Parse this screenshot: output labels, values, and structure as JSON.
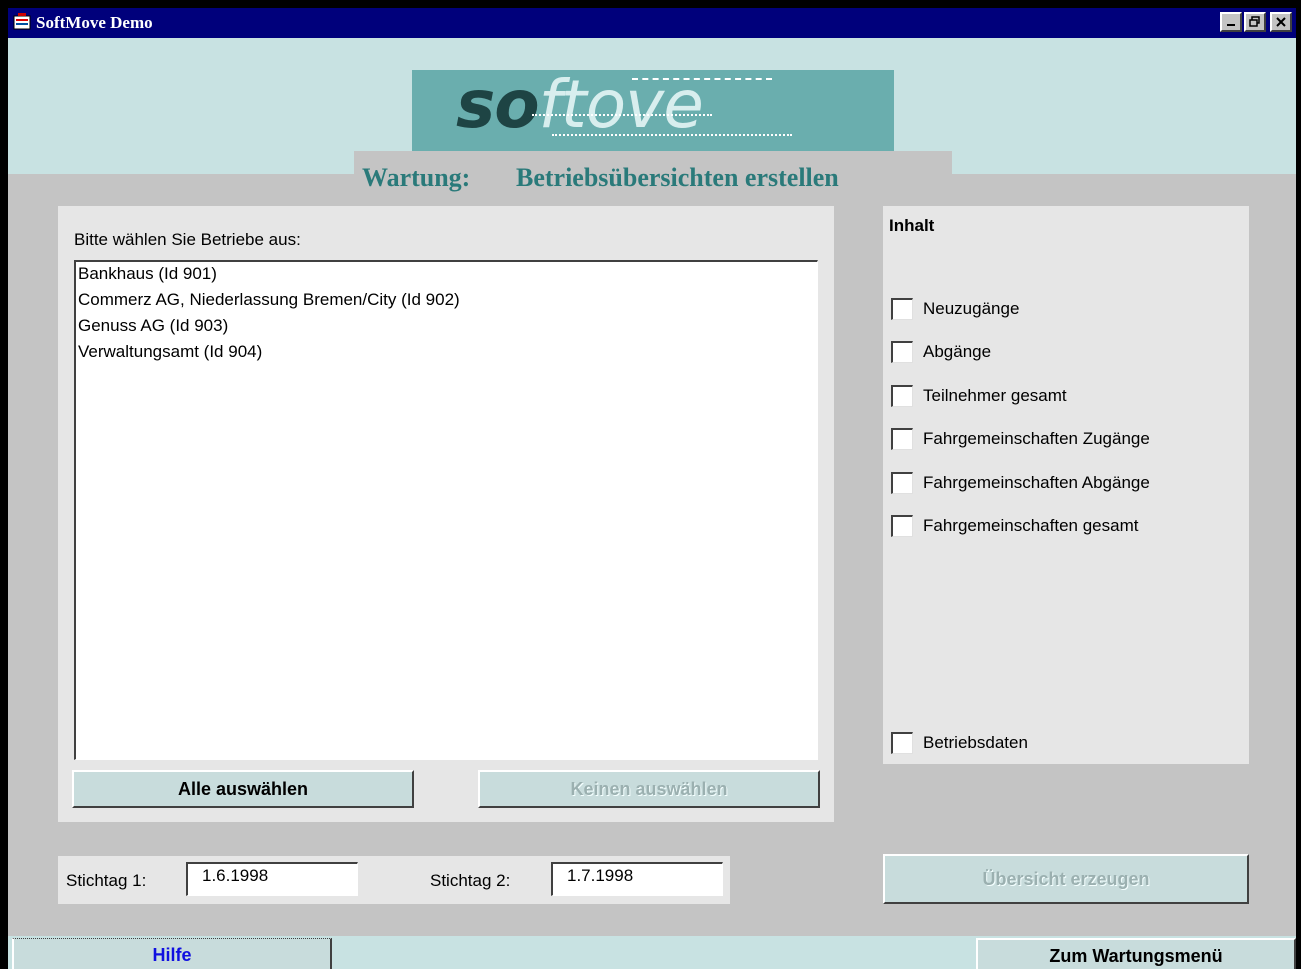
{
  "window": {
    "title": "SoftMove Demo"
  },
  "header": {
    "logo_dark": "so",
    "logo_light": "ftove",
    "section": "Wartung:",
    "page_title": "Betriebsübersichten erstellen"
  },
  "companies": {
    "label": "Bitte wählen Sie Betriebe aus:",
    "items": [
      "Bankhaus (Id 901)",
      "Commerz AG, Niederlassung Bremen/City (Id 902)",
      "Genuss AG (Id 903)",
      "Verwaltungsamt (Id 904)"
    ],
    "select_all": "Alle auswählen",
    "select_none": "Keinen auswählen"
  },
  "inhalt": {
    "title": "Inhalt",
    "options": [
      "Neuzugänge",
      "Abgänge",
      "Teilnehmer gesamt",
      "Fahrgemeinschaften Zugänge",
      "Fahrgemeinschaften Abgänge",
      "Fahrgemeinschaften gesamt"
    ],
    "betriebsdaten": "Betriebsdaten"
  },
  "dates": {
    "stichtag1_label": "Stichtag 1:",
    "stichtag1_value": "1.6.1998",
    "stichtag2_label": "Stichtag 2:",
    "stichtag2_value": "1.7.1998"
  },
  "actions": {
    "generate": "Übersicht erzeugen",
    "help": "Hilfe",
    "back": "Zum Wartungsmenü"
  }
}
